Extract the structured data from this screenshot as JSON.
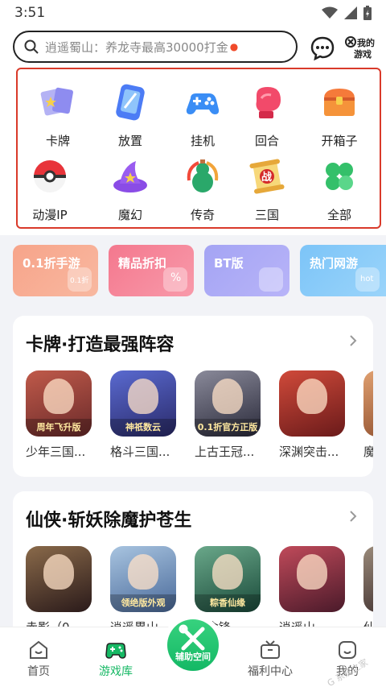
{
  "status_bar": {
    "time": "3:51"
  },
  "search": {
    "placeholder": "逍遥蜀山：养龙寺最高30000打金"
  },
  "header": {
    "my_games_label": "我的游戏",
    "my_games_line1": "我的",
    "my_games_line2": "游戏"
  },
  "categories": [
    {
      "label": "卡牌",
      "icon": "cards-icon",
      "color": "#8e8cf0"
    },
    {
      "label": "放置",
      "icon": "phone-icon",
      "color": "#4c7cf5"
    },
    {
      "label": "挂机",
      "icon": "gamepad-icon",
      "color": "#3a8df5"
    },
    {
      "label": "回合",
      "icon": "boxing-glove-icon",
      "color": "#f24a6a"
    },
    {
      "label": "开箱子",
      "icon": "treasure-chest-icon",
      "color": "#f57a3a"
    },
    {
      "label": "动漫IP",
      "icon": "pokeball-icon",
      "color": "#e8343a"
    },
    {
      "label": "魔幻",
      "icon": "wizard-hat-icon",
      "color": "#9a5cf0"
    },
    {
      "label": "传奇",
      "icon": "gourd-icon",
      "color": "#2aa86a"
    },
    {
      "label": "三国",
      "icon": "war-scroll-icon",
      "color": "#f2b640"
    },
    {
      "label": "全部",
      "icon": "clover-icon",
      "color": "#34c06a"
    }
  ],
  "category_badge": "战",
  "tags": [
    {
      "label": "0.1折手游",
      "color": "#f7a48a"
    },
    {
      "label": "精品折扣",
      "color": "#f4788e"
    },
    {
      "label": "BT版",
      "color": "#a4a4f4"
    },
    {
      "label": "热门网游",
      "color": "#7cc4f8"
    }
  ],
  "tag_decos": [
    "0.1折",
    "%",
    "",
    "hot"
  ],
  "sections": [
    {
      "title": "卡牌·打造最强阵容",
      "games": [
        {
          "name": "少年三国...",
          "banner": "周年飞升版",
          "color": "#8a3a3a"
        },
        {
          "name": "格斗三国...",
          "banner": "神祇数云",
          "color": "#3a3a8a"
        },
        {
          "name": "上古王冠...",
          "banner": "0.1折官方正版",
          "color": "#4a4a5a"
        },
        {
          "name": "深渊突击...",
          "banner": "",
          "color": "#9a2a2a"
        },
        {
          "name": "魔",
          "banner": "",
          "color": "#c07040"
        }
      ]
    },
    {
      "title": "仙侠·斩妖除魔护苍生",
      "games": [
        {
          "name": "赤影（0...",
          "banner": "",
          "color": "#5a3a2a"
        },
        {
          "name": "逍遥異山...",
          "banner": "领绝版外观",
          "color": "#6a8ab0"
        },
        {
          "name": "一念锋...",
          "banner": "粽香仙缘",
          "color": "#3a7a6a"
        },
        {
          "name": "逍遥山...",
          "banner": "",
          "color": "#8a2a3a"
        },
        {
          "name": "仙",
          "banner": "",
          "color": "#6a5a4a"
        }
      ]
    }
  ],
  "bottom_nav": [
    {
      "label": "首页",
      "icon": "home-icon"
    },
    {
      "label": "游戏库",
      "icon": "game-library-icon"
    },
    {
      "label": "辅助空间",
      "icon": "tools-icon"
    },
    {
      "label": "福利中心",
      "icon": "tv-icon"
    },
    {
      "label": "我的",
      "icon": "profile-icon"
    }
  ],
  "watermark": "G 系统之家"
}
